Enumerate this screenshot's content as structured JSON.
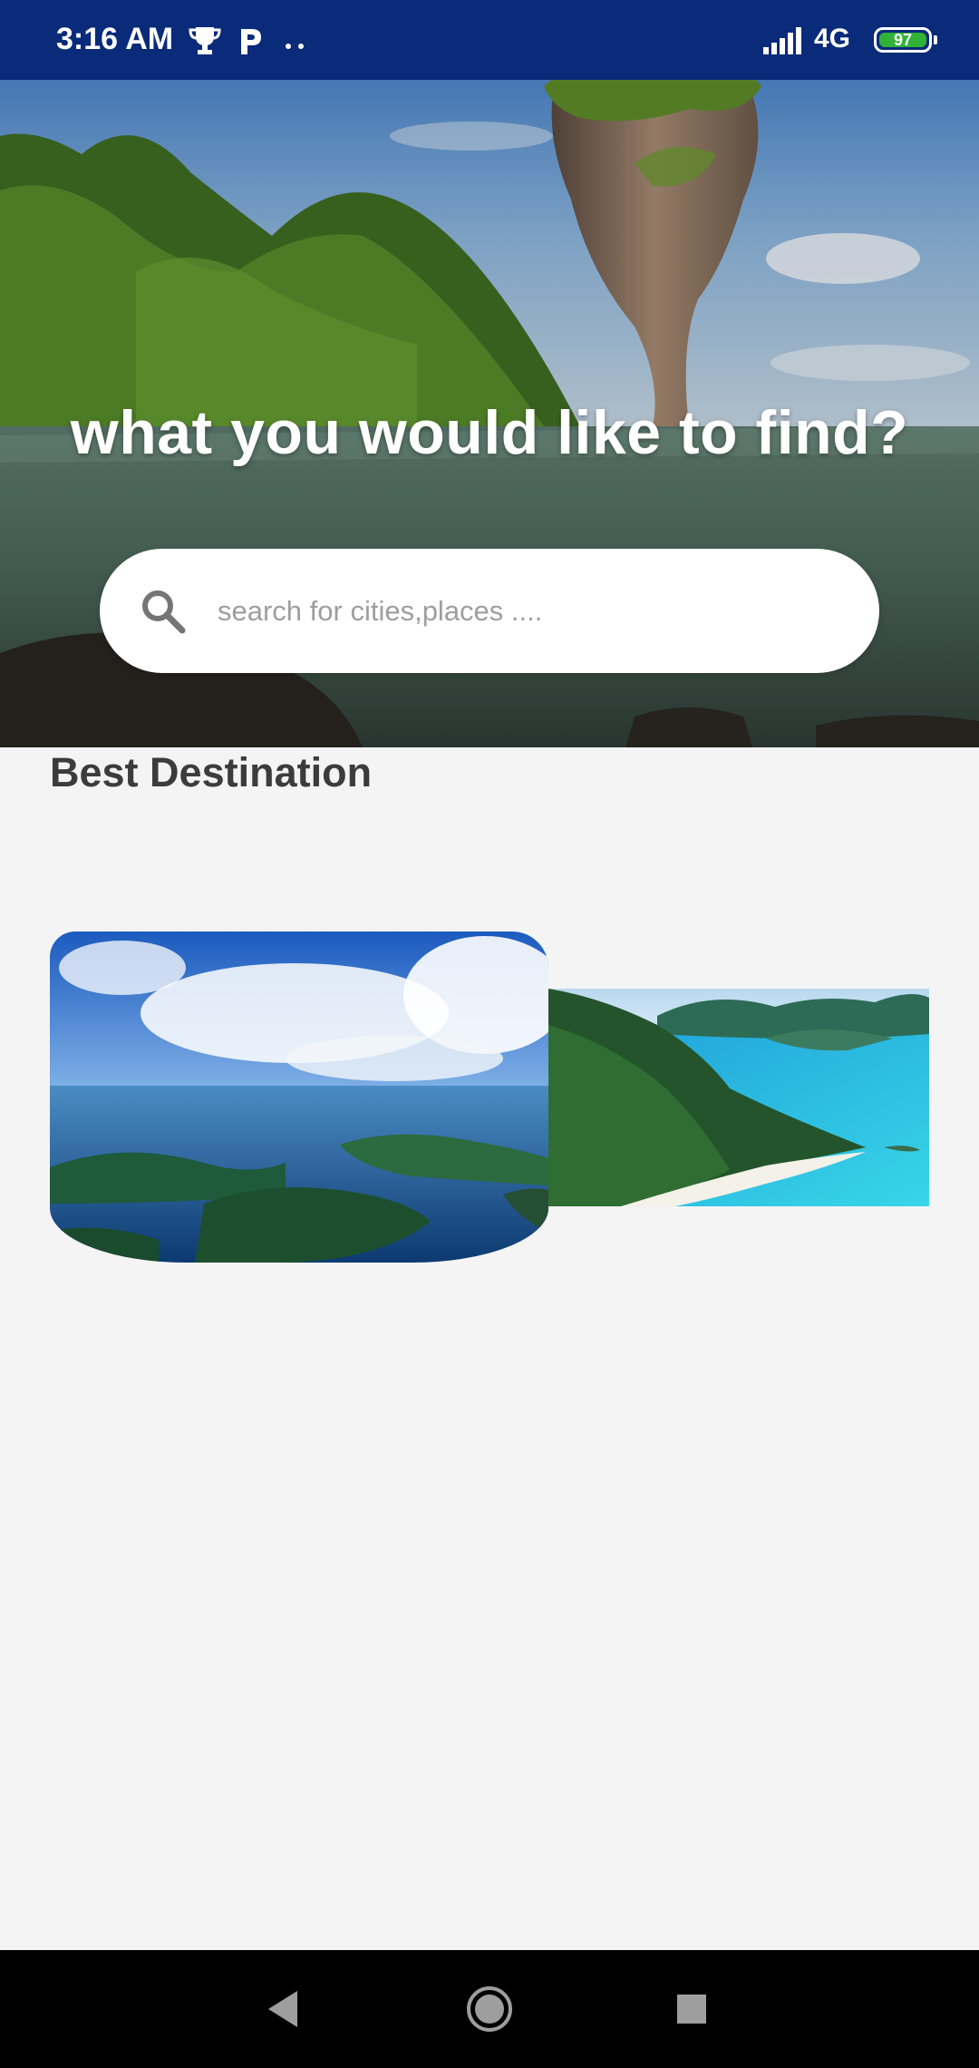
{
  "status_bar": {
    "time": "3:16 AM",
    "network": "4G",
    "battery": "97",
    "icons": [
      "trophy-icon",
      "p-icon",
      "more-dots-icon",
      "signal-icon",
      "battery-icon"
    ]
  },
  "hero": {
    "title": "what you would like to find?",
    "search": {
      "placeholder": "search for cities,places ....",
      "value": ""
    }
  },
  "section": {
    "title": "Best Destination"
  },
  "destinations": [
    {
      "image": "aerial-islands-photo"
    },
    {
      "image": "tropical-beach-photo"
    }
  ],
  "nav_bar": {
    "buttons": [
      "back-icon",
      "home-icon",
      "recents-icon"
    ]
  }
}
